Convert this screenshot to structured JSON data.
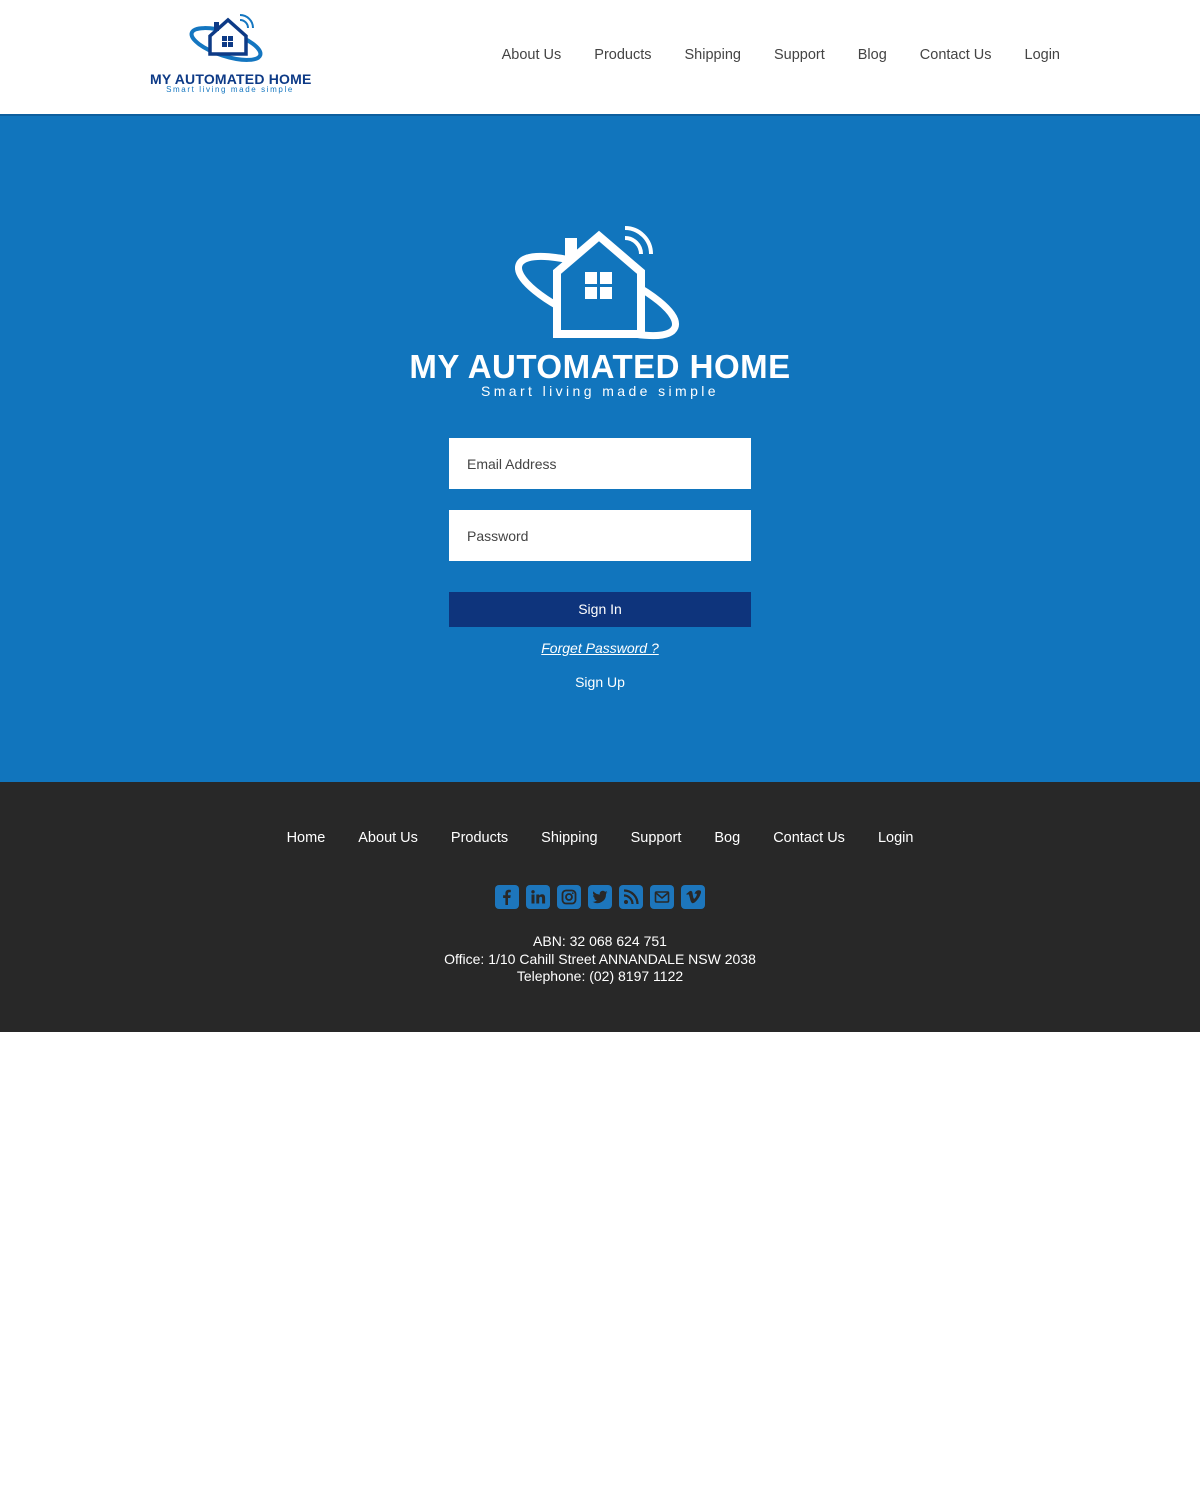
{
  "header": {
    "logo": {
      "brand": "MY AUTOMATED HOME",
      "tagline": "Smart living made simple"
    },
    "nav": [
      "About Us",
      "Products",
      "Shipping",
      "Support",
      "Blog",
      "Contact Us",
      "Login"
    ]
  },
  "hero": {
    "logo": {
      "brand": "MY AUTOMATED HOME",
      "tagline": "Smart living made simple"
    },
    "email": {
      "placeholder": "Email Address"
    },
    "password": {
      "placeholder": "Password"
    },
    "signin_label": "Sign In",
    "forgot_label": "Forget Password ?",
    "signup_label": "Sign Up"
  },
  "footer": {
    "nav": [
      "Home",
      "About Us",
      "Products",
      "Shipping",
      "Support",
      "Bog",
      "Contact Us",
      "Login"
    ],
    "social_icons": [
      "facebook-icon",
      "linkedin-icon",
      "instagram-icon",
      "twitter-icon",
      "rss-icon",
      "email-icon",
      "vimeo-icon"
    ],
    "abn": "ABN: 32 068 624 751",
    "office": "Office: 1/10 Cahill Street ANNANDALE NSW 2038",
    "telephone": "Telephone: (02) 8197 1122"
  },
  "colors": {
    "hero_bg": "#1175bd",
    "footer_bg": "#282828",
    "button_bg": "#0e347c",
    "brand_navy": "#0d3a86",
    "social_blue": "#1d76bc"
  }
}
